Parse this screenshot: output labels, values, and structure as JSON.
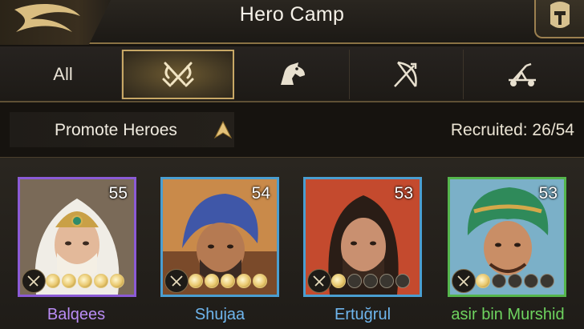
{
  "header": {
    "title": "Hero Camp"
  },
  "tabs": [
    {
      "label": "All",
      "icon": null
    },
    {
      "label": "",
      "icon": "crossed-swords-icon",
      "active": true
    },
    {
      "label": "",
      "icon": "horse-head-icon"
    },
    {
      "label": "",
      "icon": "bow-arrow-icon"
    },
    {
      "label": "",
      "icon": "catapult-icon"
    }
  ],
  "filter": {
    "promote_label": "Promote Heroes",
    "recruited": "Recruited: 26/54"
  },
  "heroes": [
    {
      "name": "Balqees",
      "level": "55",
      "stars_lit": 5,
      "frame_color": "#8b5bd6",
      "name_color": "#b98cf4"
    },
    {
      "name": "Shujaa",
      "level": "54",
      "stars_lit": 5,
      "frame_color": "#4a9ed1",
      "name_color": "#6fb6ee"
    },
    {
      "name": "Ertuğrul",
      "level": "53",
      "stars_lit": 1,
      "frame_color": "#4a9ed1",
      "name_color": "#6fb6ee"
    },
    {
      "name": "asir bin Murshid",
      "level": "53",
      "stars_lit": 1,
      "frame_color": "#55b54c",
      "name_color": "#6ed35f"
    }
  ],
  "colors": {
    "accent_gold": "#c8a866",
    "background": "#16130f"
  }
}
